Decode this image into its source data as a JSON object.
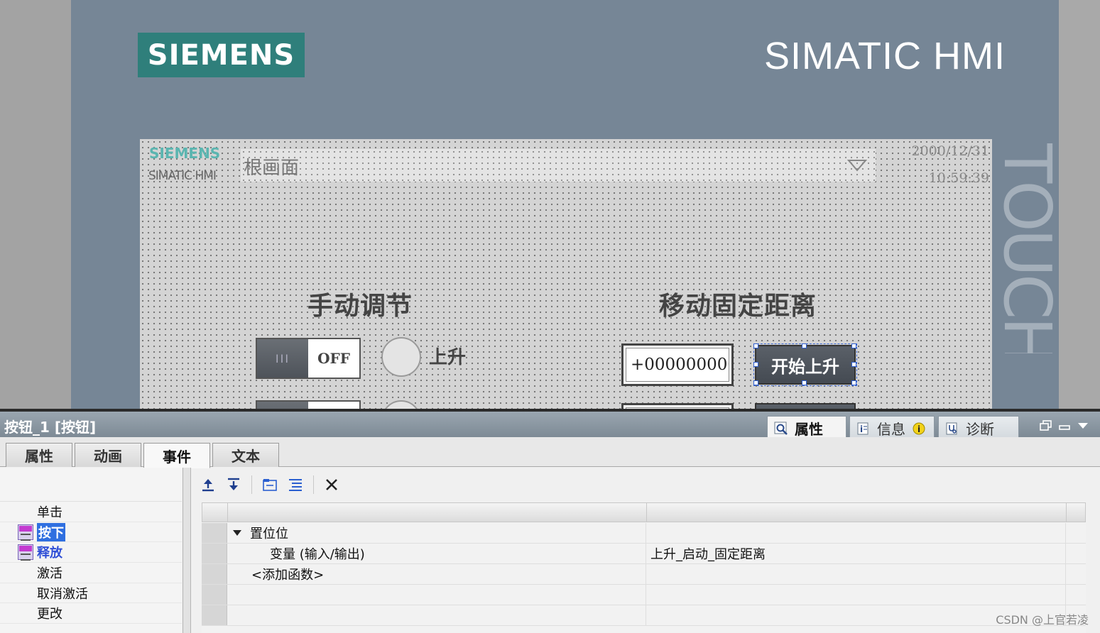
{
  "hmi": {
    "brand_logo": "SIEMENS",
    "model_title": "SIMATIC HMI",
    "side_label": "TOUCH",
    "screen": {
      "brand": "SIEMENS",
      "brand_sub": "SIMATIC HMI",
      "screen_selector": "根画面",
      "date": "2000/12/31",
      "time": "10:59:39",
      "section_manual": "手动调节",
      "section_move": "移动固定距离",
      "switch_knob": "III",
      "switch_state": "OFF",
      "lamp_label": "上升",
      "io_value": "+000000000.",
      "start_up_button": "开始上升"
    }
  },
  "inspector": {
    "title": "按钮_1 [按钮]",
    "top_tabs": {
      "properties": "属性",
      "info": "信息",
      "diagnostics": "诊断"
    },
    "sub_tabs": {
      "properties": "属性",
      "animation": "动画",
      "events": "事件",
      "text": "文本"
    },
    "events": [
      "单击",
      "按下",
      "释放",
      "激活",
      "取消激活",
      "更改"
    ],
    "functions": {
      "function_name": "置位位",
      "param_label": "变量 (输入/输出)",
      "param_value": "上升_启动_固定距离",
      "add_function": "<添加函数>"
    }
  },
  "watermark": "CSDN @上官若凌",
  "colors": {
    "siemens_teal": "#2f7f7b",
    "hmi_frame": "#768696",
    "selection_blue": "#2f6fe0"
  }
}
